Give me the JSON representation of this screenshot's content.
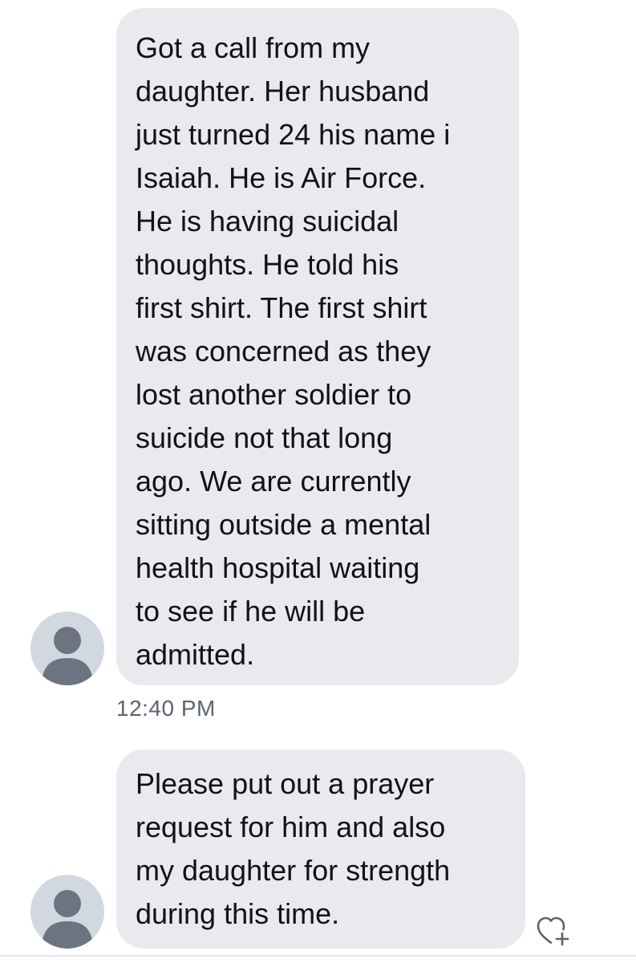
{
  "messages": [
    {
      "lines": [
        "Got a call from my",
        "daughter. Her husband",
        "just turned 24 his name i",
        "Isaiah. He is Air Force.",
        "He is having suicidal",
        "thoughts. He told his",
        "first shirt. The first shirt",
        "was concerned as they",
        "lost another soldier to",
        "suicide not that long",
        "ago. We are currently",
        "sitting outside a mental",
        "health hospital waiting",
        "to see if he will be",
        "admitted."
      ],
      "timestamp": "12:40 PM",
      "avatar_icon": "default-user-avatar-icon"
    },
    {
      "lines": [
        "Please put out a prayer",
        "request for him and also",
        "my daughter for strength",
        "during this time."
      ],
      "avatar_icon": "default-user-avatar-icon",
      "reaction_icon": "add-reaction-heart-icon"
    }
  ],
  "colors": {
    "bubble_background": "#eaeaee",
    "message_text": "#111216",
    "timestamp_text": "#5b6470",
    "avatar_background": "#d2d8e0",
    "avatar_figure": "#6b7480"
  }
}
